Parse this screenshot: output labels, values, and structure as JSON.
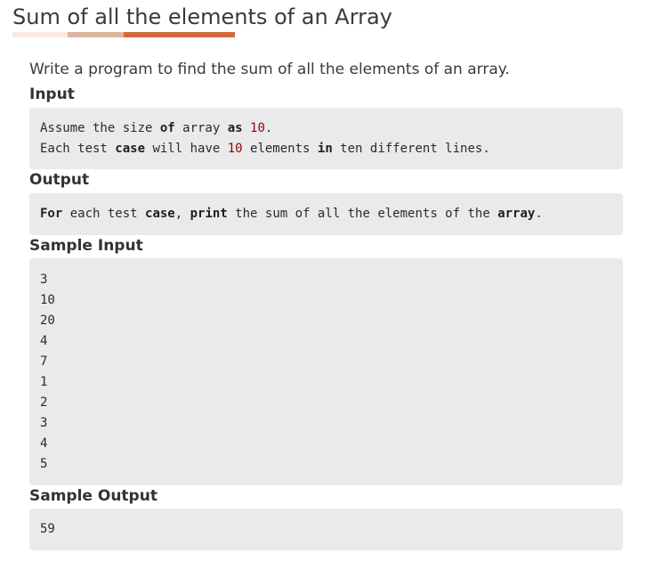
{
  "page": {
    "title": "Sum of all the elements of an Array",
    "description": "Write a program to find the sum of all the elements of an array."
  },
  "colors": {
    "accent_light": "#fbe9e0",
    "accent_mid": "#dcb59e",
    "accent_strong": "#d2693d",
    "code_background": "#eaeaea",
    "code_number": "#990000"
  },
  "sections": {
    "input": {
      "heading": "Input",
      "lines": [
        [
          {
            "t": "Assume the size ",
            "s": "plain"
          },
          {
            "t": "of",
            "s": "kw"
          },
          {
            "t": " array ",
            "s": "plain"
          },
          {
            "t": "as",
            "s": "kw"
          },
          {
            "t": " ",
            "s": "plain"
          },
          {
            "t": "10",
            "s": "num"
          },
          {
            "t": ".",
            "s": "plain"
          }
        ],
        [
          {
            "t": "Each test ",
            "s": "plain"
          },
          {
            "t": "case",
            "s": "kw"
          },
          {
            "t": " will have ",
            "s": "plain"
          },
          {
            "t": "10",
            "s": "num"
          },
          {
            "t": " elements ",
            "s": "plain"
          },
          {
            "t": "in",
            "s": "kw"
          },
          {
            "t": " ten different lines.",
            "s": "plain"
          }
        ]
      ]
    },
    "output": {
      "heading": "Output",
      "lines": [
        [
          {
            "t": "For",
            "s": "kw"
          },
          {
            "t": " each test ",
            "s": "plain"
          },
          {
            "t": "case",
            "s": "kw"
          },
          {
            "t": ", ",
            "s": "plain"
          },
          {
            "t": "print",
            "s": "kw"
          },
          {
            "t": " the sum of all the elements of the ",
            "s": "plain"
          },
          {
            "t": "array",
            "s": "kw"
          },
          {
            "t": ".",
            "s": "plain"
          }
        ]
      ]
    },
    "sample_input": {
      "heading": "Sample Input",
      "lines": [
        "3",
        "10",
        "20",
        "4",
        "7",
        "1",
        "2",
        "3",
        "4",
        "5"
      ]
    },
    "sample_output": {
      "heading": "Sample Output",
      "lines": [
        "59"
      ]
    }
  }
}
